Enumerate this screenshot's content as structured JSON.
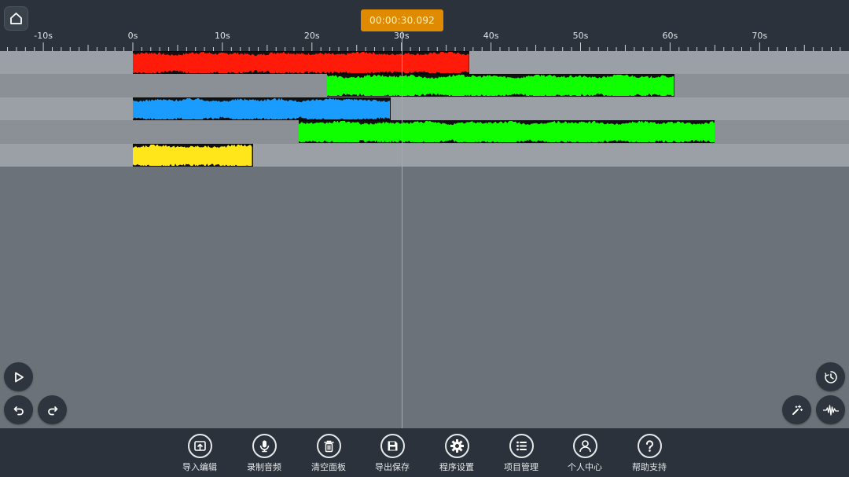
{
  "header": {
    "home_icon": "home-icon",
    "playhead_time": "00:00:30.092"
  },
  "ruler": {
    "labels": [
      "-10s",
      "0s",
      "10s",
      "20s",
      "30s",
      "40s",
      "50s",
      "60s",
      "70s"
    ]
  },
  "tracks": [
    {
      "color": "#ff1a0a",
      "start_s": 0,
      "end_s": 37.6
    },
    {
      "color": "#10ff00",
      "start_s": 21.7,
      "end_s": 60.5
    },
    {
      "color": "#1a9cff",
      "start_s": 0,
      "end_s": 28.8
    },
    {
      "color": "#10ff00",
      "start_s": 18.5,
      "end_s": 65.0
    },
    {
      "color": "#ffe61a",
      "start_s": 0,
      "end_s": 13.4
    }
  ],
  "track_row_colors": [
    "#9aa0a6",
    "#8a9096"
  ],
  "controls": {
    "play_icon": "play-icon",
    "undo_icon": "undo-icon",
    "redo_icon": "redo-icon",
    "timer_icon": "timer-icon",
    "effects_icon": "magic-wand-icon",
    "waveform_icon": "waveform-icon"
  },
  "toolbar": {
    "items": [
      {
        "label": "导入编辑",
        "icon": "import-icon"
      },
      {
        "label": "录制音频",
        "icon": "microphone-icon"
      },
      {
        "label": "清空面板",
        "icon": "trash-icon"
      },
      {
        "label": "导出保存",
        "icon": "save-icon"
      },
      {
        "label": "程序设置",
        "icon": "gear-icon"
      },
      {
        "label": "项目管理",
        "icon": "list-icon"
      },
      {
        "label": "个人中心",
        "icon": "user-icon"
      },
      {
        "label": "帮助支持",
        "icon": "help-icon"
      }
    ]
  },
  "colors": {
    "topbar": "#2b323b",
    "accent": "#e08a00",
    "workspace": "#6b7279"
  }
}
